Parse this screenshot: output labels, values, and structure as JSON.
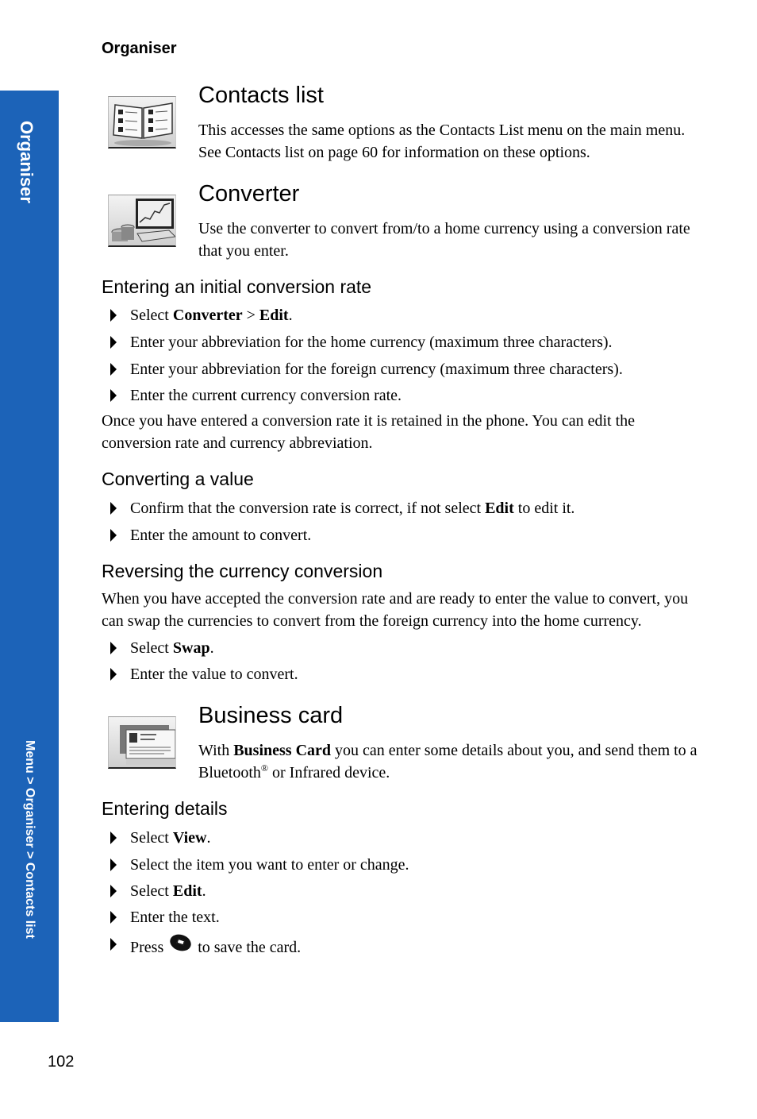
{
  "running_head": "Organiser",
  "side_tab": {
    "section": "Organiser",
    "breadcrumb": "Menu > Organiser > Contacts list",
    "color": "#1c63b8"
  },
  "contacts_list": {
    "icon": "contacts-book-icon",
    "title": "Contacts list",
    "body": "This accesses the same options as the Contacts List menu on the main menu. See Contacts list on page 60 for information on these options."
  },
  "converter": {
    "icon": "converter-chart-icon",
    "title": "Converter",
    "body": "Use the converter to convert from/to a home currency using a conversion rate that you enter.",
    "initial_rate": {
      "heading": "Entering an initial conversion rate",
      "steps": [
        {
          "pre": "Select ",
          "b1": "Converter",
          "mid": " > ",
          "b2": "Edit",
          "post": "."
        },
        {
          "text": "Enter your abbreviation for the home currency (maximum three characters)."
        },
        {
          "text": "Enter your abbreviation for the foreign currency (maximum three characters)."
        },
        {
          "text": "Enter the current currency conversion rate."
        }
      ],
      "note": "Once you have entered a conversion rate it is retained in the phone. You can edit the conversion rate and currency abbreviation."
    },
    "converting": {
      "heading": "Converting a value",
      "steps": [
        {
          "pre": "Confirm that the conversion rate is correct, if not select ",
          "b1": "Edit",
          "post": " to edit it."
        },
        {
          "text": "Enter the amount to convert."
        }
      ]
    },
    "reversing": {
      "heading": "Reversing the currency conversion",
      "body": "When you have accepted the conversion rate and are ready to enter the value to convert, you can swap the currencies to convert from the foreign currency into the home currency.",
      "steps": [
        {
          "pre": "Select ",
          "b1": "Swap",
          "post": "."
        },
        {
          "text": "Enter the value to convert."
        }
      ]
    }
  },
  "business_card": {
    "icon": "business-card-icon",
    "title": "Business card",
    "body_pre": "With ",
    "body_bold": "Business Card",
    "body_mid": " you can enter some details about you, and send them to a Bluetooth",
    "body_sup": "®",
    "body_post": " or Infrared device.",
    "entering": {
      "heading": "Entering details",
      "steps": [
        {
          "pre": "Select ",
          "b1": "View",
          "post": "."
        },
        {
          "text": "Select the item you want to enter or change."
        },
        {
          "pre": "Select ",
          "b1": "Edit",
          "post": "."
        },
        {
          "text": "Enter the text."
        },
        {
          "pre": "Press ",
          "key_icon": "message-key-icon",
          "post": " to save the card."
        }
      ]
    }
  },
  "page_number": "102"
}
